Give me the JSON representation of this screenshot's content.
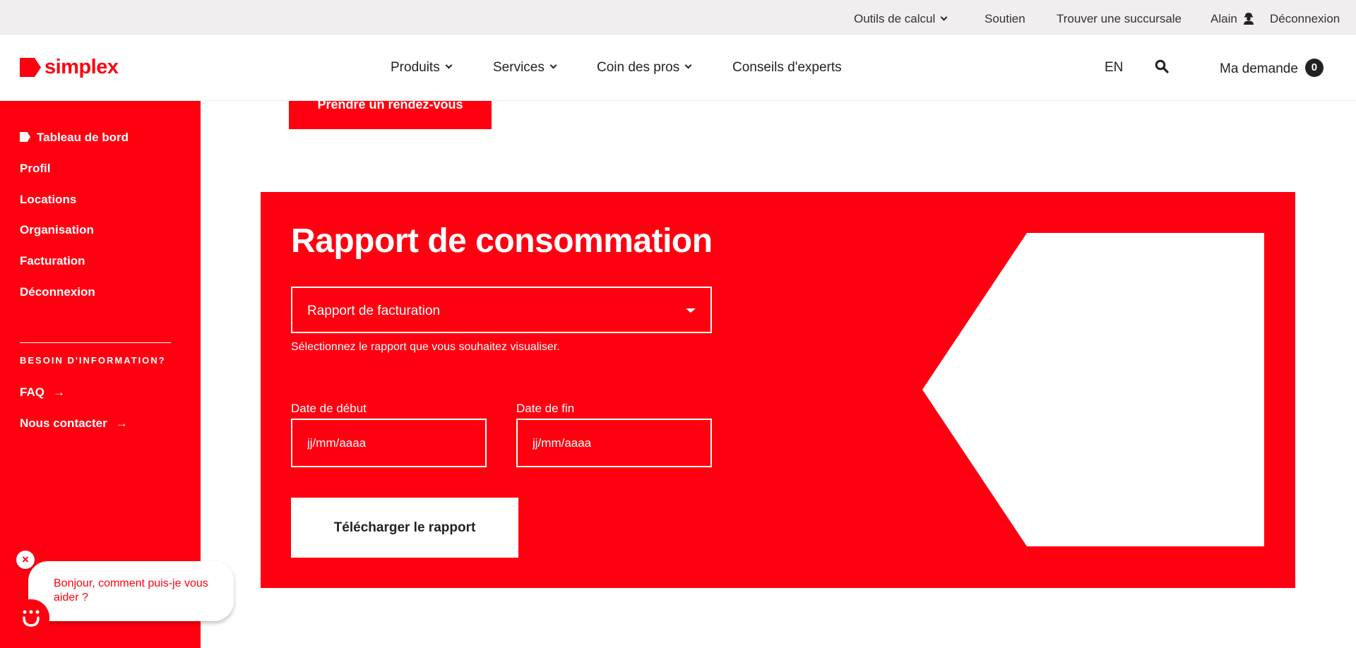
{
  "topbar": {
    "items": [
      {
        "label": "Outils de calcul",
        "has_dropdown": true
      },
      {
        "label": "Soutien"
      },
      {
        "label": "Trouver une succursale"
      },
      {
        "label": "Alain",
        "icon": "worker-user-icon"
      },
      {
        "label": "Déconnexion"
      }
    ]
  },
  "header": {
    "logo_text": "simplex",
    "nav": [
      {
        "label": "Produits",
        "has_dropdown": true
      },
      {
        "label": "Services",
        "has_dropdown": true
      },
      {
        "label": "Coin des pros",
        "has_dropdown": true
      },
      {
        "label": "Conseils d'experts"
      }
    ],
    "lang": "EN",
    "search_icon": "search-icon",
    "cart_label": "Ma demande",
    "cart_count": "0"
  },
  "sidebar": {
    "items": [
      {
        "label": "Tableau de bord",
        "active": true
      },
      {
        "label": "Profil"
      },
      {
        "label": "Locations"
      },
      {
        "label": "Organisation"
      },
      {
        "label": "Facturation"
      },
      {
        "label": "Déconnexion"
      }
    ],
    "info_heading": "BESOIN D'INFORMATION?",
    "links": [
      {
        "label": "FAQ",
        "arrow": "→"
      },
      {
        "label": "Nous contacter",
        "arrow": "→"
      }
    ]
  },
  "main": {
    "appointment_button": "Prendre un rendez-vous",
    "panel": {
      "title": "Rapport de consommation",
      "report_select_value": "Rapport de facturation",
      "report_helper": "Sélectionnez le rapport que vous souhaitez visualiser.",
      "start_date_label": "Date de début",
      "start_date_placeholder": "jj/mm/aaaa",
      "end_date_label": "Date de fin",
      "end_date_placeholder": "jj/mm/aaaa",
      "download_button": "Télécharger le rapport"
    }
  },
  "chat": {
    "close_glyph": "×",
    "message": "Bonjour, comment puis-je vous aider ?"
  },
  "colors": {
    "brand_red": "#ff0010",
    "topbar_bg": "#f0eeef",
    "text_dark": "#222222"
  }
}
